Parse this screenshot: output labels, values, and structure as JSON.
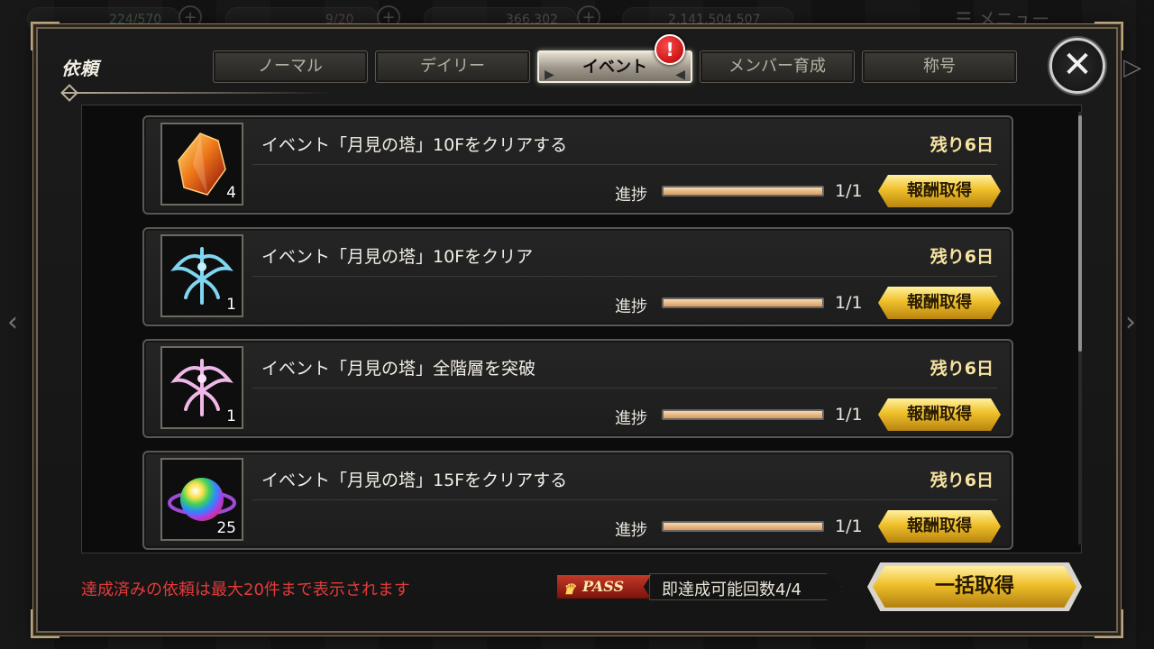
{
  "hud": {
    "ap": "224/570",
    "bp": "9/20",
    "gold": "366,302",
    "coins": "2,141,504,507",
    "menu": "メニュー"
  },
  "panel": {
    "title": "依頼"
  },
  "tabs": [
    {
      "label": "ノーマル",
      "active": false
    },
    {
      "label": "デイリー",
      "active": false
    },
    {
      "label": "イベント",
      "active": true
    },
    {
      "label": "メンバー育成",
      "active": false
    },
    {
      "label": "称号",
      "active": false
    }
  ],
  "alert_badge": "!",
  "quests": [
    {
      "icon": "red-crystal-icon",
      "count": "4",
      "title": "イベント「月見の塔」10Fをクリアする",
      "remaining": "残り6日",
      "progress_label": "進捗",
      "progress": 1.0,
      "progress_text": "1/1",
      "button": "報酬取得"
    },
    {
      "icon": "blue-crest-icon",
      "count": "1",
      "title": "イベント「月見の塔」10Fをクリア",
      "remaining": "残り6日",
      "progress_label": "進捗",
      "progress": 1.0,
      "progress_text": "1/1",
      "button": "報酬取得"
    },
    {
      "icon": "pink-crest-icon",
      "count": "1",
      "title": "イベント「月見の塔」全階層を突破",
      "remaining": "残り6日",
      "progress_label": "進捗",
      "progress": 1.0,
      "progress_text": "1/1",
      "button": "報酬取得"
    },
    {
      "icon": "rainbow-orb-icon",
      "count": "25",
      "title": "イベント「月見の塔」15Fをクリアする",
      "remaining": "残り6日",
      "progress_label": "進捗",
      "progress": 1.0,
      "progress_text": "1/1",
      "button": "報酬取得"
    }
  ],
  "footer": {
    "note": "達成済みの依頼は最大20件まで表示されます",
    "pass_label": "PASS",
    "instant_text": "即達成可能回数4/4",
    "bulk_button": "一括取得"
  },
  "colors": {
    "accent_gold": "#f0c02a",
    "warning_red": "#e43a3a",
    "remaining_text": "#f8e3a0"
  }
}
